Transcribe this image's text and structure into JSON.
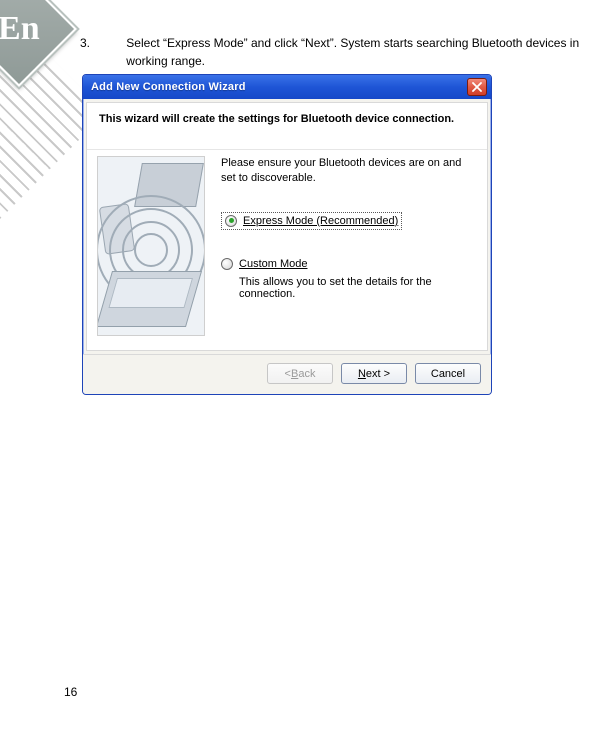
{
  "page_number": "16",
  "lang_badge": "En",
  "instruction": {
    "number": "3.",
    "text": "Select “Express Mode” and click “Next”. System starts searching Bluetooth devices in working range."
  },
  "dialog": {
    "title": "Add New Connection Wizard",
    "heading": "This wizard will create the settings for Bluetooth device connection.",
    "hint": "Please ensure your Bluetooth devices are on and set to discoverable.",
    "express": {
      "prefix": "E",
      "rest": "xpress Mode (Recommended)"
    },
    "custom": {
      "prefix": "C",
      "rest": "ustom Mode"
    },
    "custom_desc": "This allows you to set the details for the connection.",
    "buttons": {
      "back": {
        "lt": "< ",
        "mn": "B",
        "rest": "ack"
      },
      "next": {
        "mn": "N",
        "rest": "ext >"
      },
      "cancel": "Cancel"
    }
  }
}
